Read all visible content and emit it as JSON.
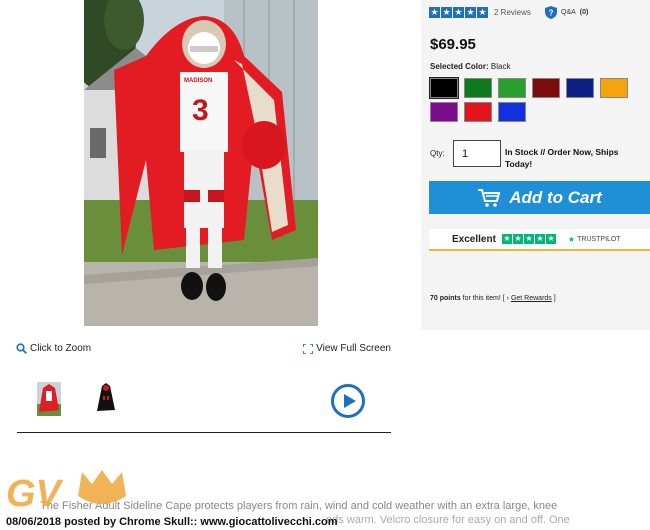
{
  "product": {
    "price": "$69.95",
    "selected_color_label": "Selected Color:",
    "selected_color_value": "Black",
    "colors": [
      {
        "name": "Black",
        "hex": "#000000"
      },
      {
        "name": "Dark Green",
        "hex": "#0d7a1e"
      },
      {
        "name": "Green",
        "hex": "#27a02d"
      },
      {
        "name": "Maroon",
        "hex": "#7d0b0b"
      },
      {
        "name": "Navy",
        "hex": "#0e1f86"
      },
      {
        "name": "Gold",
        "hex": "#f6a40b"
      },
      {
        "name": "Purple",
        "hex": "#7d0c8c"
      },
      {
        "name": "Red",
        "hex": "#e3131b"
      },
      {
        "name": "Royal Blue",
        "hex": "#1330e0"
      }
    ]
  },
  "rating": {
    "stars": 5,
    "reviews_label": "2 Reviews",
    "qa_label": "Q&A",
    "qa_count": "(0)",
    "accent": "#1f6fbf"
  },
  "purchase": {
    "qty_label": "Qty:",
    "qty_value": "1",
    "stock_text": "In Stock // Order Now, Ships Today!",
    "cart_label": "Add to Cart",
    "cart_color": "#1f8fd8"
  },
  "trustpilot": {
    "rating_word": "Excellent",
    "brand": "TRUSTPILOT",
    "star_color": "#00b67a"
  },
  "rewards": {
    "points_label": "70 points",
    "points_suffix": " for this item!",
    "bracket_open": "[ ›",
    "get_rewards": "Get Rewards",
    "bracket_close": "]"
  },
  "gallery": {
    "zoom_label": "Click to Zoom",
    "fullscreen_label": "View Full Screen"
  },
  "description": {
    "line1": "The Fisher Adult Sideline Cape protects players from rain, wind and cold weather with an extra large, knee",
    "line2": "nds warm. Velcro closure for easy on and off. One"
  },
  "watermark": {
    "logo_text": "GV",
    "caption": "08/06/2018 posted by Chrome Skull:: www.giocattolivecchi.com"
  },
  "jersey": {
    "number": "3",
    "name_text": "MADISON"
  }
}
